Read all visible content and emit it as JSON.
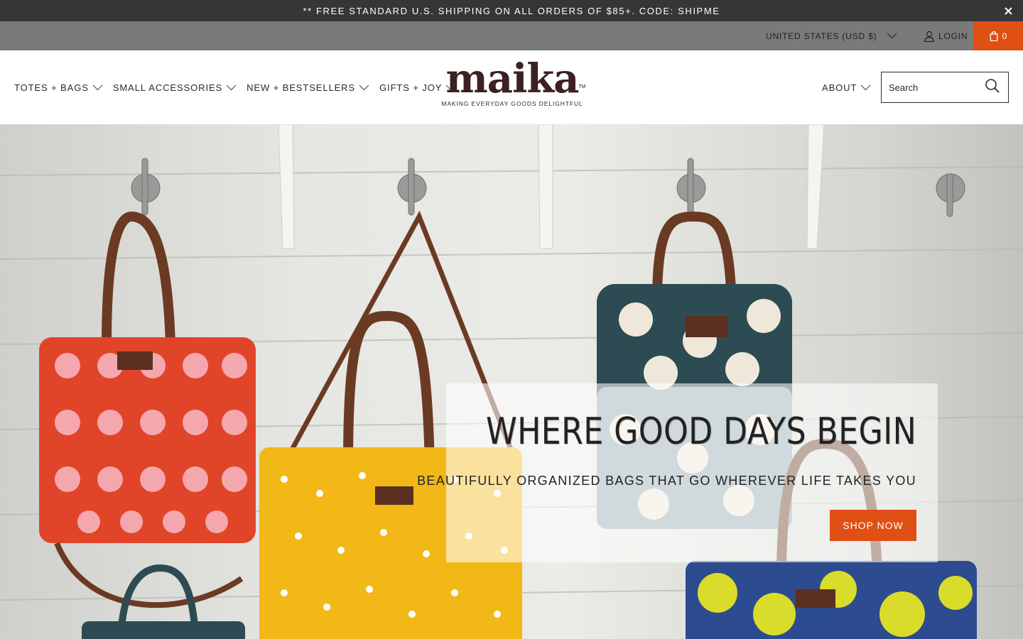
{
  "announcement": {
    "text": "** FREE STANDARD U.S. SHIPPING ON ALL ORDERS OF $85+. CODE: SHIPME",
    "close_icon": "close-icon"
  },
  "utility": {
    "currency": "UNITED STATES (USD $)",
    "login": "LOGIN",
    "cart_count": "0"
  },
  "nav": {
    "items": [
      {
        "label": "TOTES + BAGS"
      },
      {
        "label": "SMALL ACCESSORIES"
      },
      {
        "label": "NEW + BESTSELLERS"
      },
      {
        "label": "GIFTS + JOY"
      }
    ],
    "about": "ABOUT"
  },
  "logo": {
    "wordmark": "maika",
    "trademark": "TM",
    "tagline": "MAKING EVERYDAY GOODS DELIGHTFUL"
  },
  "search": {
    "placeholder": "Search"
  },
  "hero": {
    "title": "WHERE GOOD DAYS BEGIN",
    "subtitle": "BEAUTIFULLY ORGANIZED BAGS THAT GO WHEREVER LIFE TAKES YOU",
    "cta": "SHOP NOW"
  },
  "colors": {
    "accent": "#e04f14",
    "announcement_bg": "#363636",
    "utility_bg": "#7a7a7a",
    "brand": "#3d2022"
  }
}
